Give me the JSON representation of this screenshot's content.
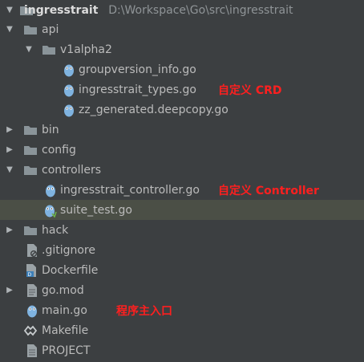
{
  "project": {
    "name": "ingresstrait",
    "path": "D:\\Workspace\\Go\\src\\ingresstrait"
  },
  "tree": {
    "api": "api",
    "v1alpha2": "v1alpha2",
    "groupversion_info": "groupversion_info.go",
    "ingresstrait_types": "ingresstrait_types.go",
    "zz_generated": "zz_generated.deepcopy.go",
    "bin": "bin",
    "config": "config",
    "controllers": "controllers",
    "ingresstrait_controller": "ingresstrait_controller.go",
    "suite_test": "suite_test.go",
    "hack": "hack",
    "gitignore": ".gitignore",
    "dockerfile": "Dockerfile",
    "gomod": "go.mod",
    "maingo": "main.go",
    "makefile": "Makefile",
    "project_file": "PROJECT"
  },
  "annotations": {
    "crd": "自定义 CRD",
    "controller": "自定义 Controller",
    "entry": "程序主入口"
  },
  "colors": {
    "background": "#3c3f41",
    "selected_row": "#4b4f46",
    "folder": "#8a9499",
    "gopher": "#7fb3e0",
    "annotation": "#ff1f1f"
  },
  "icons": {
    "folder": "folder-icon",
    "go_file": "gopher-icon",
    "text_file": "text-file-icon",
    "docker_file": "docker-file-icon",
    "makefile": "makefile-icon",
    "gomod_file": "gomod-file-icon"
  }
}
